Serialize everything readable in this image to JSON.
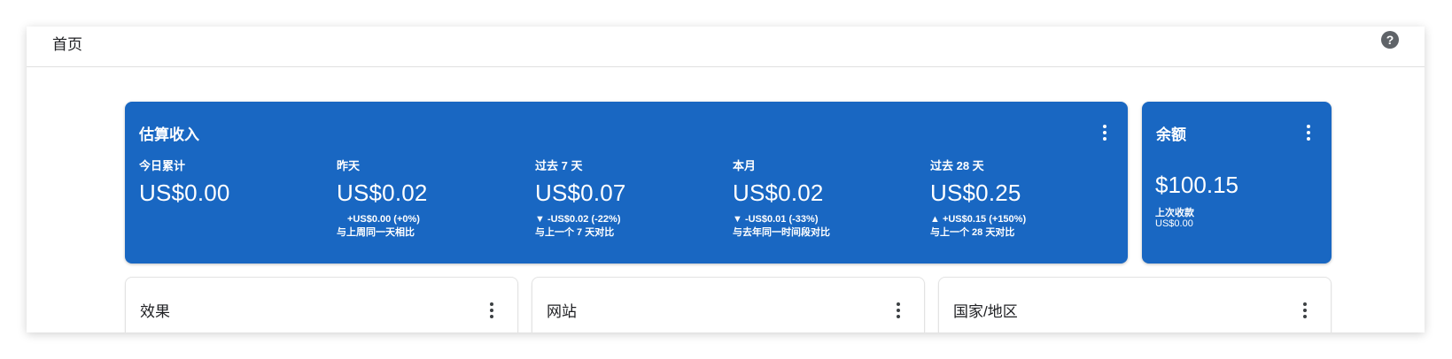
{
  "header": {
    "title": "首页",
    "help_icon": "help-circle-icon"
  },
  "earnings_card": {
    "title": "估算收入",
    "metrics": [
      {
        "label": "今日累计",
        "value": "US$0.00",
        "change": "",
        "compare": ""
      },
      {
        "label": "昨天",
        "value": "US$0.02",
        "change": "+US$0.00 (+0%)",
        "compare": "与上周同一天相比"
      },
      {
        "label": "过去 7 天",
        "value": "US$0.07",
        "change": "▼ -US$0.02 (-22%)",
        "compare": "与上一个 7 天对比"
      },
      {
        "label": "本月",
        "value": "US$0.02",
        "change": "▼ -US$0.01 (-33%)",
        "compare": "与去年同一时间段对比"
      },
      {
        "label": "过去 28 天",
        "value": "US$0.25",
        "change": "▲ +US$0.15 (+150%)",
        "compare": "与上一个 28 天对比"
      }
    ]
  },
  "balance_card": {
    "title": "余额",
    "value": "$100.15",
    "last_payment_label": "上次收款",
    "last_payment_amount": "US$0.00"
  },
  "lower_cards": [
    {
      "title": "效果"
    },
    {
      "title": "网站"
    },
    {
      "title": "国家/地区"
    }
  ],
  "colors": {
    "card_blue": "#1967c2",
    "icon_gray": "#5f6368"
  }
}
